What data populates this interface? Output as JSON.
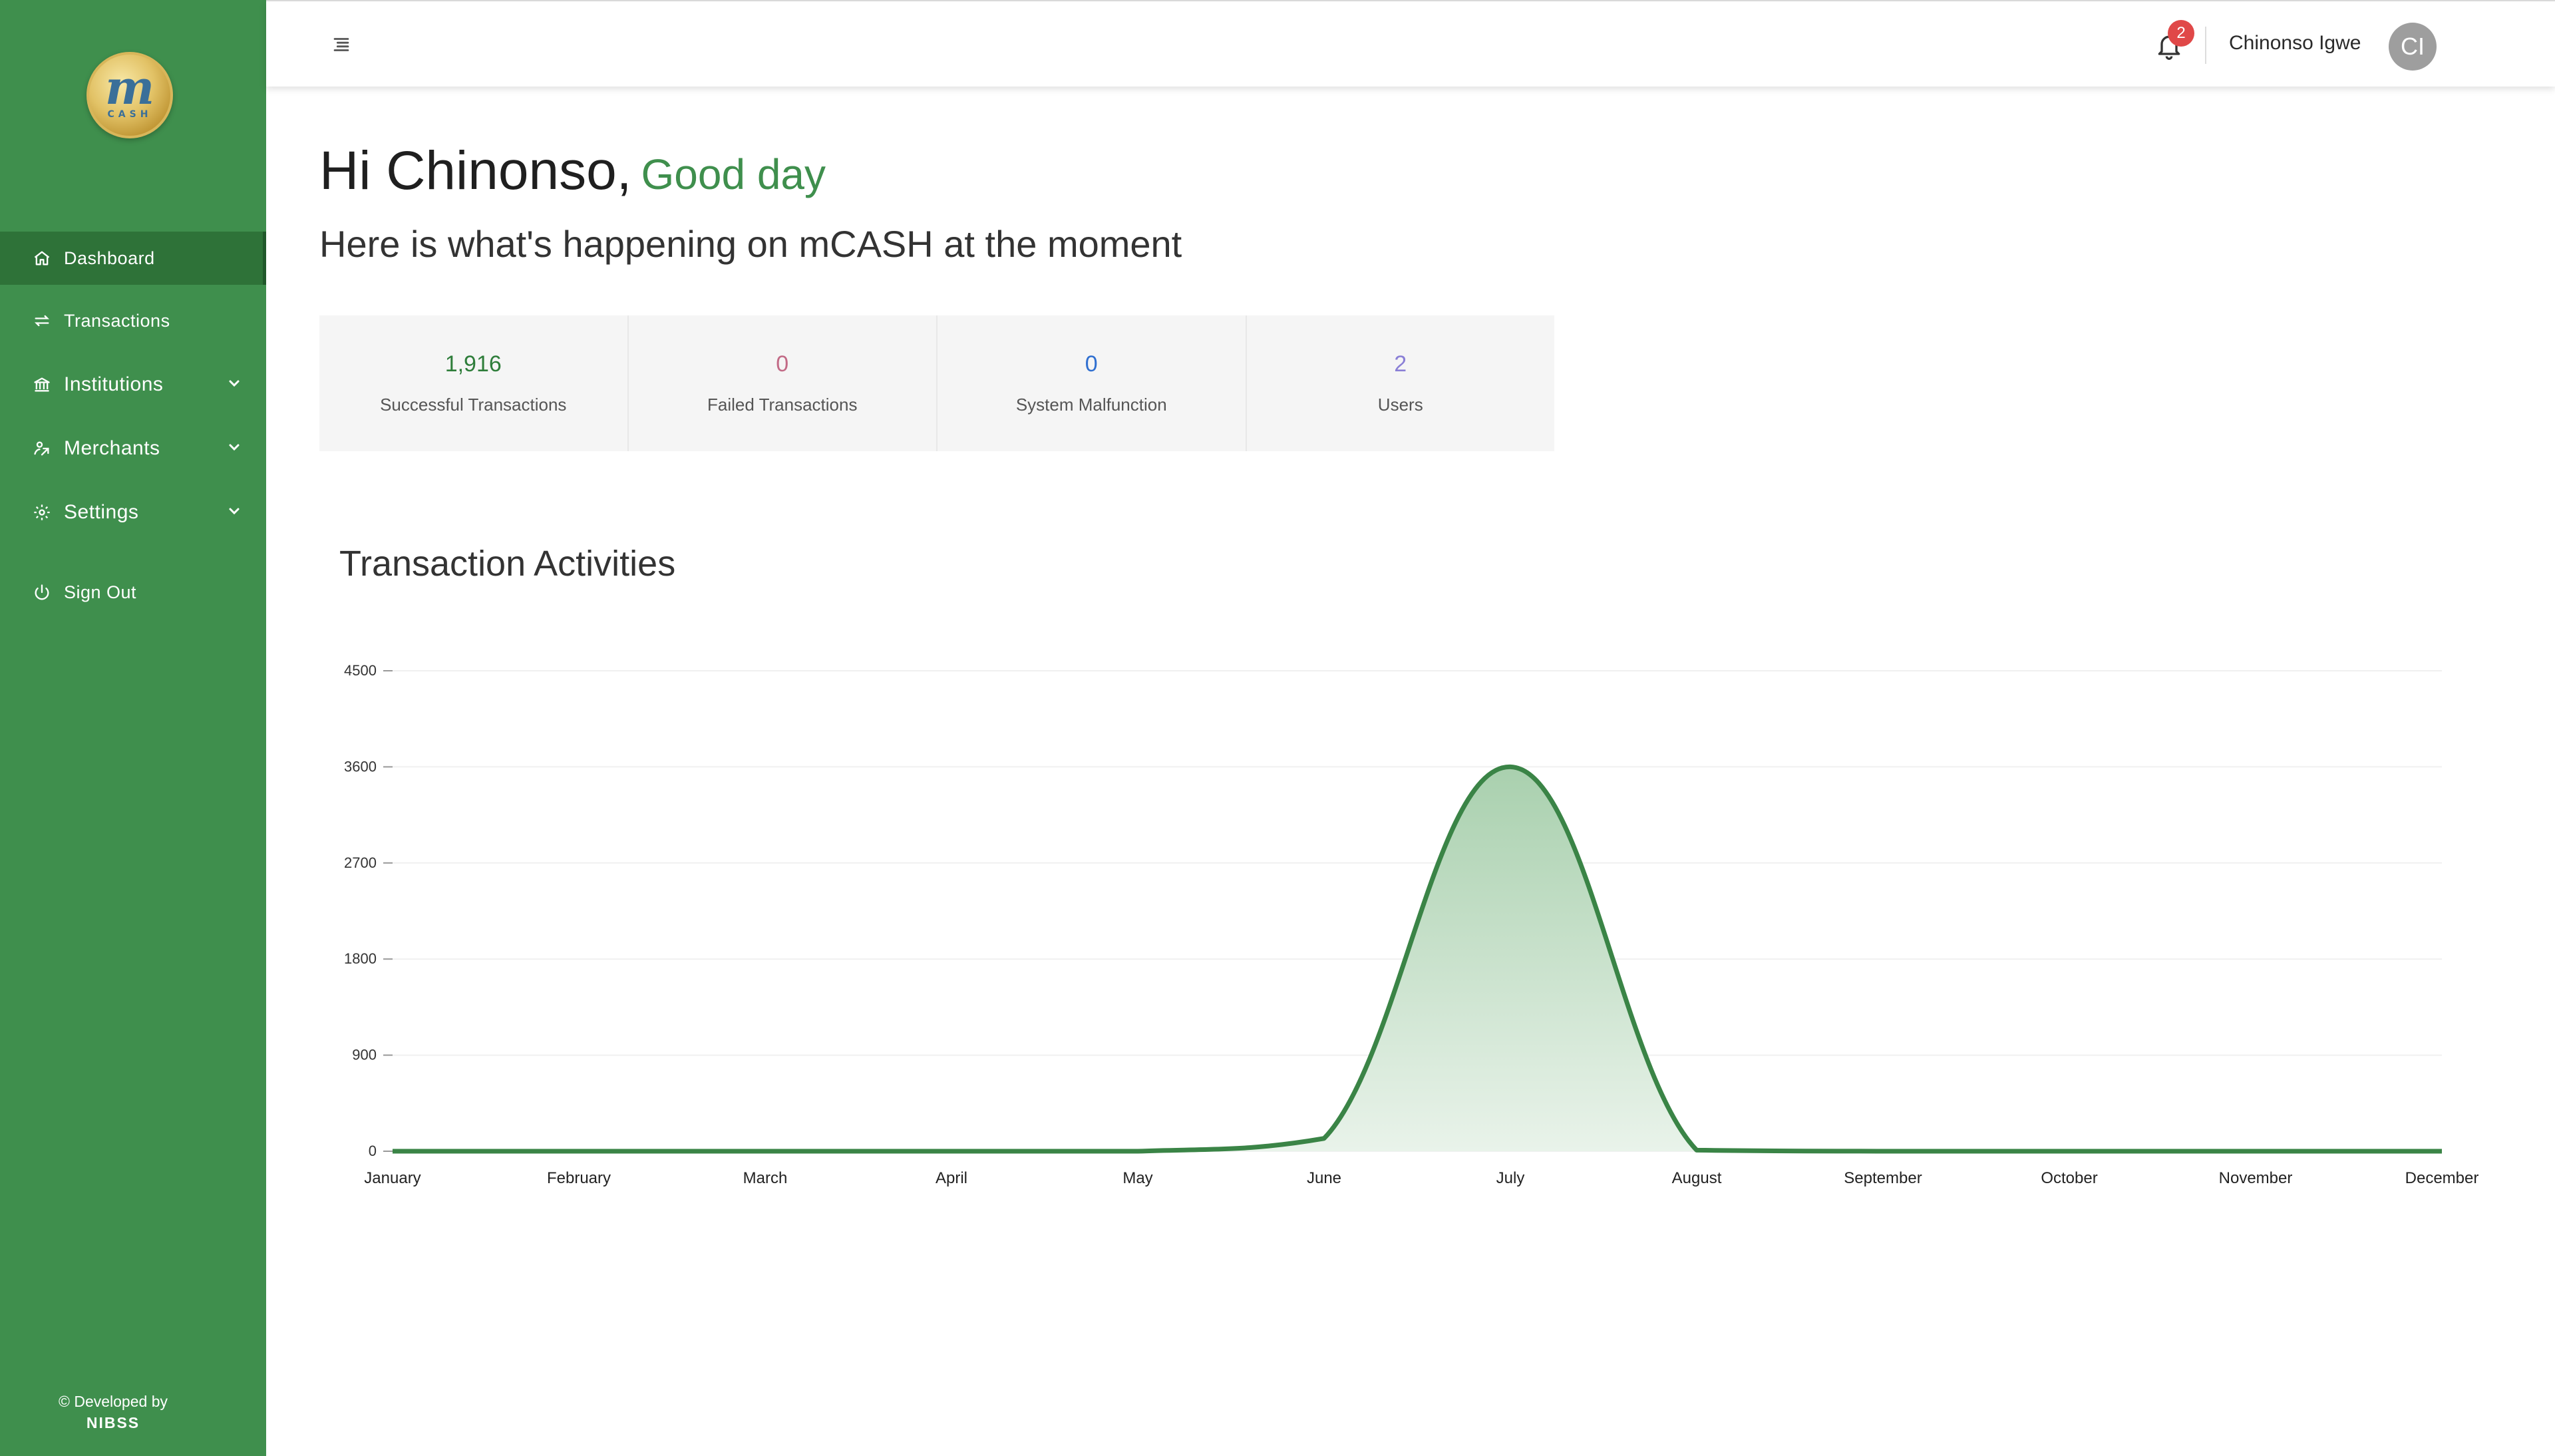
{
  "sidebar": {
    "logo_main": "m",
    "logo_sub": "CASH",
    "items": [
      {
        "label": "Dashboard"
      },
      {
        "label": "Transactions"
      },
      {
        "label": "Institutions"
      },
      {
        "label": "Merchants"
      },
      {
        "label": "Settings"
      },
      {
        "label": "Sign Out"
      }
    ],
    "credit_line1": "© Developed by",
    "credit_line2": "NIBSS"
  },
  "topbar": {
    "notification_count": "2",
    "user_name": "Chinonso Igwe",
    "avatar_initials": "CI"
  },
  "greeting": {
    "hi": "Hi Chinonso,",
    "good_day": "Good day",
    "subtitle": "Here is what's happening on mCASH at the moment"
  },
  "stats": [
    {
      "value": "1,916",
      "label": "Successful Transactions",
      "color": "#2e7d3a"
    },
    {
      "value": "0",
      "label": "Failed Transactions",
      "color": "#c26a86"
    },
    {
      "value": "0",
      "label": "System Malfunction",
      "color": "#2f6fd0"
    },
    {
      "value": "2",
      "label": "Users",
      "color": "#8a7fd6"
    }
  ],
  "chart_title": "Transaction Activities",
  "chart_data": {
    "type": "area",
    "title": "Transaction Activities",
    "categories": [
      "January",
      "February",
      "March",
      "April",
      "May",
      "June",
      "July",
      "August",
      "September",
      "October",
      "November",
      "December"
    ],
    "values": [
      0,
      0,
      0,
      0,
      0,
      120,
      3600,
      10,
      0,
      0,
      0,
      0
    ],
    "ylim": [
      0,
      4500
    ],
    "yticks": [
      0,
      900,
      1800,
      2700,
      3600,
      4500
    ],
    "grid": true,
    "colors": {
      "line": "#3a8446",
      "fill_top": "#a9d0ae",
      "fill_bottom": "#e9f3ea"
    }
  }
}
